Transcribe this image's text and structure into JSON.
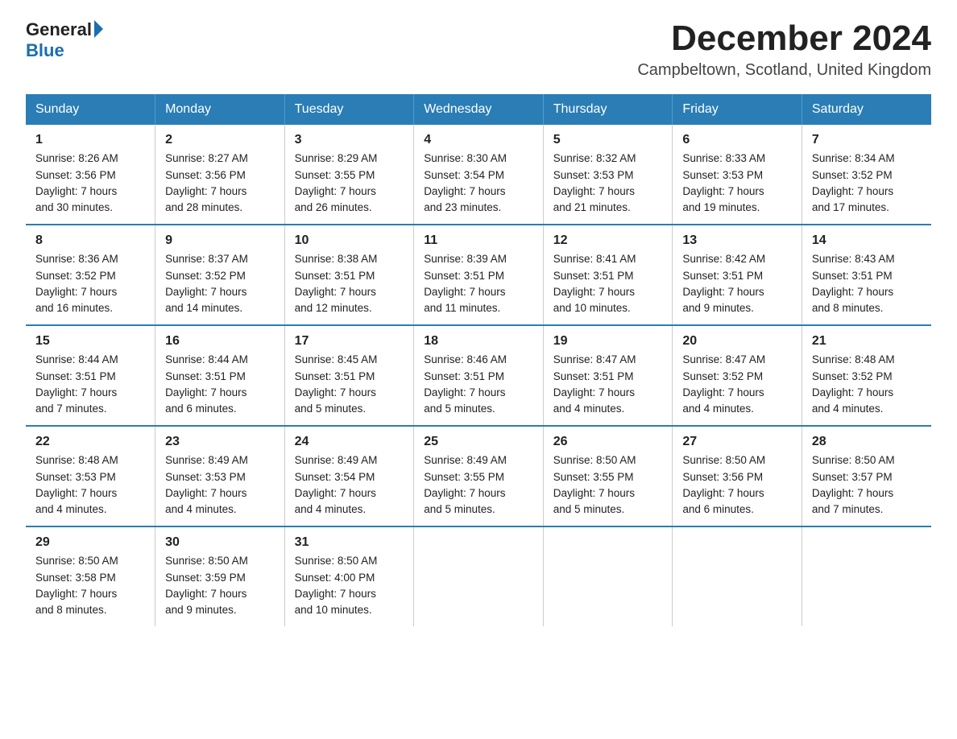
{
  "logo": {
    "general": "General",
    "blue": "Blue"
  },
  "title": "December 2024",
  "location": "Campbeltown, Scotland, United Kingdom",
  "days_header": [
    "Sunday",
    "Monday",
    "Tuesday",
    "Wednesday",
    "Thursday",
    "Friday",
    "Saturday"
  ],
  "weeks": [
    [
      {
        "day": "1",
        "sunrise": "8:26 AM",
        "sunset": "3:56 PM",
        "daylight": "7 hours and 30 minutes."
      },
      {
        "day": "2",
        "sunrise": "8:27 AM",
        "sunset": "3:56 PM",
        "daylight": "7 hours and 28 minutes."
      },
      {
        "day": "3",
        "sunrise": "8:29 AM",
        "sunset": "3:55 PM",
        "daylight": "7 hours and 26 minutes."
      },
      {
        "day": "4",
        "sunrise": "8:30 AM",
        "sunset": "3:54 PM",
        "daylight": "7 hours and 23 minutes."
      },
      {
        "day": "5",
        "sunrise": "8:32 AM",
        "sunset": "3:53 PM",
        "daylight": "7 hours and 21 minutes."
      },
      {
        "day": "6",
        "sunrise": "8:33 AM",
        "sunset": "3:53 PM",
        "daylight": "7 hours and 19 minutes."
      },
      {
        "day": "7",
        "sunrise": "8:34 AM",
        "sunset": "3:52 PM",
        "daylight": "7 hours and 17 minutes."
      }
    ],
    [
      {
        "day": "8",
        "sunrise": "8:36 AM",
        "sunset": "3:52 PM",
        "daylight": "7 hours and 16 minutes."
      },
      {
        "day": "9",
        "sunrise": "8:37 AM",
        "sunset": "3:52 PM",
        "daylight": "7 hours and 14 minutes."
      },
      {
        "day": "10",
        "sunrise": "8:38 AM",
        "sunset": "3:51 PM",
        "daylight": "7 hours and 12 minutes."
      },
      {
        "day": "11",
        "sunrise": "8:39 AM",
        "sunset": "3:51 PM",
        "daylight": "7 hours and 11 minutes."
      },
      {
        "day": "12",
        "sunrise": "8:41 AM",
        "sunset": "3:51 PM",
        "daylight": "7 hours and 10 minutes."
      },
      {
        "day": "13",
        "sunrise": "8:42 AM",
        "sunset": "3:51 PM",
        "daylight": "7 hours and 9 minutes."
      },
      {
        "day": "14",
        "sunrise": "8:43 AM",
        "sunset": "3:51 PM",
        "daylight": "7 hours and 8 minutes."
      }
    ],
    [
      {
        "day": "15",
        "sunrise": "8:44 AM",
        "sunset": "3:51 PM",
        "daylight": "7 hours and 7 minutes."
      },
      {
        "day": "16",
        "sunrise": "8:44 AM",
        "sunset": "3:51 PM",
        "daylight": "7 hours and 6 minutes."
      },
      {
        "day": "17",
        "sunrise": "8:45 AM",
        "sunset": "3:51 PM",
        "daylight": "7 hours and 5 minutes."
      },
      {
        "day": "18",
        "sunrise": "8:46 AM",
        "sunset": "3:51 PM",
        "daylight": "7 hours and 5 minutes."
      },
      {
        "day": "19",
        "sunrise": "8:47 AM",
        "sunset": "3:51 PM",
        "daylight": "7 hours and 4 minutes."
      },
      {
        "day": "20",
        "sunrise": "8:47 AM",
        "sunset": "3:52 PM",
        "daylight": "7 hours and 4 minutes."
      },
      {
        "day": "21",
        "sunrise": "8:48 AM",
        "sunset": "3:52 PM",
        "daylight": "7 hours and 4 minutes."
      }
    ],
    [
      {
        "day": "22",
        "sunrise": "8:48 AM",
        "sunset": "3:53 PM",
        "daylight": "7 hours and 4 minutes."
      },
      {
        "day": "23",
        "sunrise": "8:49 AM",
        "sunset": "3:53 PM",
        "daylight": "7 hours and 4 minutes."
      },
      {
        "day": "24",
        "sunrise": "8:49 AM",
        "sunset": "3:54 PM",
        "daylight": "7 hours and 4 minutes."
      },
      {
        "day": "25",
        "sunrise": "8:49 AM",
        "sunset": "3:55 PM",
        "daylight": "7 hours and 5 minutes."
      },
      {
        "day": "26",
        "sunrise": "8:50 AM",
        "sunset": "3:55 PM",
        "daylight": "7 hours and 5 minutes."
      },
      {
        "day": "27",
        "sunrise": "8:50 AM",
        "sunset": "3:56 PM",
        "daylight": "7 hours and 6 minutes."
      },
      {
        "day": "28",
        "sunrise": "8:50 AM",
        "sunset": "3:57 PM",
        "daylight": "7 hours and 7 minutes."
      }
    ],
    [
      {
        "day": "29",
        "sunrise": "8:50 AM",
        "sunset": "3:58 PM",
        "daylight": "7 hours and 8 minutes."
      },
      {
        "day": "30",
        "sunrise": "8:50 AM",
        "sunset": "3:59 PM",
        "daylight": "7 hours and 9 minutes."
      },
      {
        "day": "31",
        "sunrise": "8:50 AM",
        "sunset": "4:00 PM",
        "daylight": "7 hours and 10 minutes."
      },
      null,
      null,
      null,
      null
    ]
  ],
  "labels": {
    "sunrise": "Sunrise:",
    "sunset": "Sunset:",
    "daylight": "Daylight:"
  }
}
